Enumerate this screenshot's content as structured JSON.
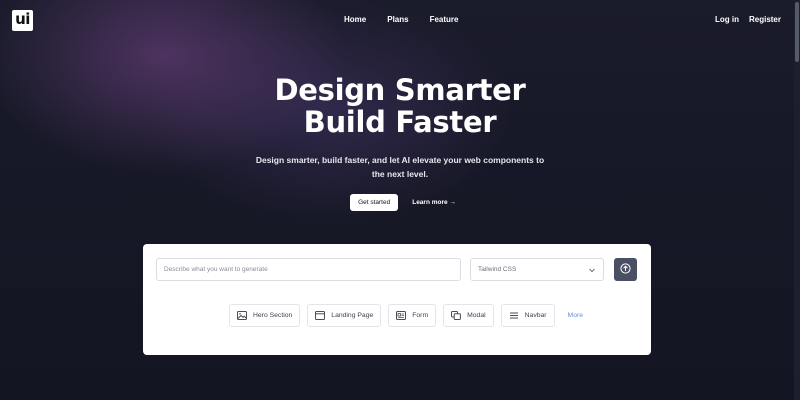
{
  "brand": {
    "logo_text": "ui"
  },
  "nav": {
    "links": [
      "Home",
      "Plans",
      "Feature"
    ],
    "login": "Log in",
    "register": "Register"
  },
  "hero": {
    "title_line1": "Design Smarter",
    "title_line2": "Build Faster",
    "subtitle": "Design smarter, build faster, and let AI elevate your web components to the next level.",
    "get_started": "Get started",
    "learn_more": "Learn more →"
  },
  "generator": {
    "prompt_placeholder": "Describe what you want to generate",
    "framework_selected": "Tailwind CSS",
    "chips": [
      {
        "label": "Hero Section",
        "icon": "image-icon"
      },
      {
        "label": "Landing Page",
        "icon": "browser-window-icon"
      },
      {
        "label": "Form",
        "icon": "form-icon"
      },
      {
        "label": "Modal",
        "icon": "layers-icon"
      },
      {
        "label": "Navbar",
        "icon": "menu-icon"
      }
    ],
    "more": "More"
  },
  "colors": {
    "background": "#151725",
    "glow": "#78488c",
    "accent_link": "#6d8fd6",
    "submit_button": "#4a5063"
  }
}
